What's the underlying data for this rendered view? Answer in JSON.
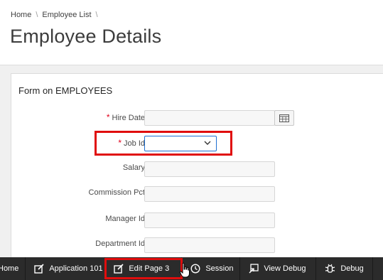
{
  "breadcrumb": {
    "items": [
      "Home",
      "Employee List"
    ]
  },
  "page_title": "Employee Details",
  "form": {
    "title": "Form on EMPLOYEES",
    "fields": [
      {
        "label": "Hire Date",
        "required": true,
        "value": ""
      },
      {
        "label": "Job Id",
        "required": true,
        "value": ""
      },
      {
        "label": "Salary",
        "required": false,
        "value": ""
      },
      {
        "label": "Commission Pct",
        "required": false,
        "value": ""
      },
      {
        "label": "Manager Id",
        "required": false,
        "value": ""
      },
      {
        "label": "Department Id",
        "required": false,
        "value": ""
      }
    ]
  },
  "devbar": {
    "home": "Home",
    "application": "Application 101",
    "edit_page": "Edit Page 3",
    "session": "Session",
    "view_debug": "View Debug",
    "debug": "Debug"
  },
  "colors": {
    "highlight": "#e00d0d",
    "required": "#e0001b",
    "focus": "#1f6fd1",
    "devbar_bg": "#2b2b2b"
  }
}
